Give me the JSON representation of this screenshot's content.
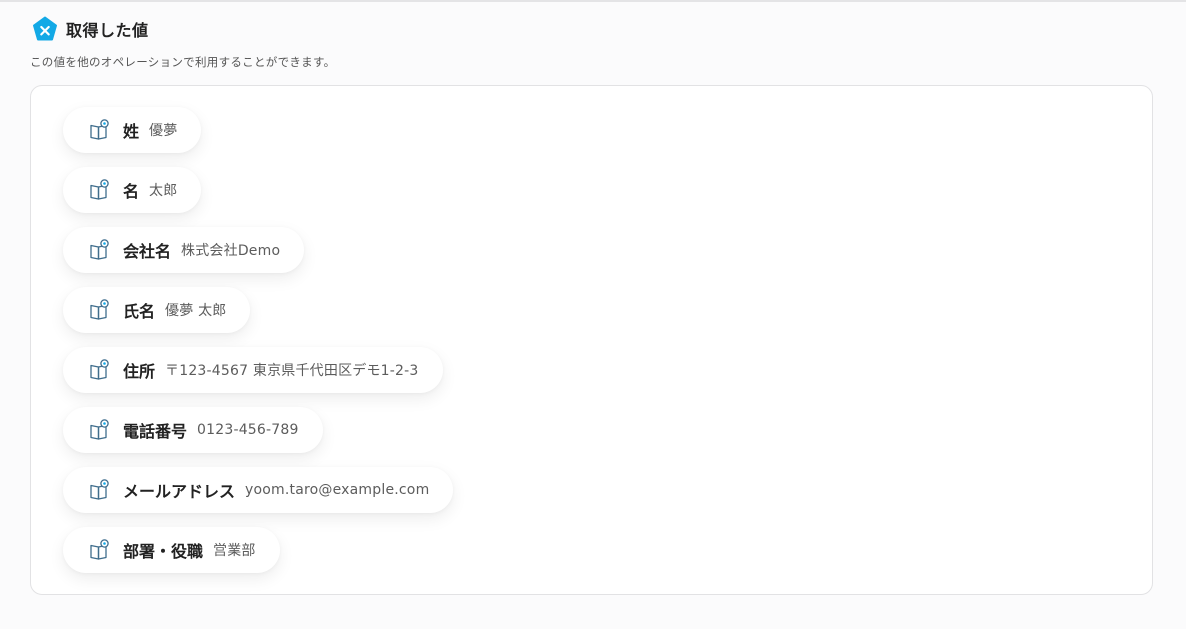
{
  "section": {
    "title": "取得した値",
    "description": "この値を他のオペレーションで利用することができます。"
  },
  "fields": [
    {
      "label": "姓",
      "value": "優夢"
    },
    {
      "label": "名",
      "value": "太郎"
    },
    {
      "label": "会社名",
      "value": "株式会社Demo"
    },
    {
      "label": "氏名",
      "value": "優夢 太郎"
    },
    {
      "label": "住所",
      "value": "〒123-4567 東京県千代田区デモ1-2-3"
    },
    {
      "label": "電話番号",
      "value": "0123-456-789"
    },
    {
      "label": "メールアドレス",
      "value": "yoom.taro@example.com"
    },
    {
      "label": "部署・役職",
      "value": "営業部"
    }
  ],
  "icons": {
    "section_icon": "variable-icon",
    "field_icon": "book-pin-icon"
  },
  "colors": {
    "accent": "#13a9e6",
    "field_icon_stroke": "#3f6d8c"
  }
}
